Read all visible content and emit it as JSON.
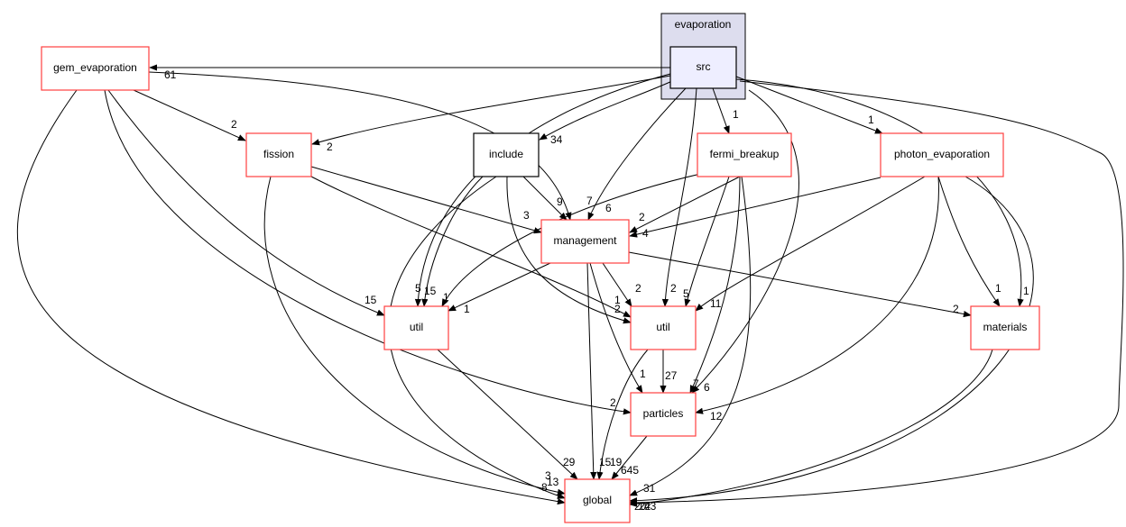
{
  "graph": {
    "cluster": {
      "label": "evaporation",
      "fill": "#ddddee",
      "border": "#000000"
    },
    "nodes": {
      "src": {
        "label": "src",
        "fill": "#eeeeff",
        "border": "#000000"
      },
      "gem_evaporation": {
        "label": "gem_evaporation",
        "border": "#ff0000"
      },
      "fission": {
        "label": "fission",
        "border": "#ff0000"
      },
      "include": {
        "label": "include",
        "border": "#000000"
      },
      "fermi_breakup": {
        "label": "fermi_breakup",
        "border": "#ff0000"
      },
      "photon_evaporation": {
        "label": "photon_evaporation",
        "border": "#ff0000"
      },
      "management": {
        "label": "management",
        "border": "#ff0000"
      },
      "util_1": {
        "label": "util",
        "border": "#ff0000"
      },
      "util_2": {
        "label": "util",
        "border": "#ff0000"
      },
      "materials": {
        "label": "materials",
        "border": "#ff0000"
      },
      "particles": {
        "label": "particles",
        "border": "#ff0000"
      },
      "global": {
        "label": "global",
        "border": "#ff0000"
      }
    },
    "edges": [
      {
        "from": "src",
        "to": "gem_evaporation",
        "count": "61"
      },
      {
        "from": "gem_evaporation",
        "to": "fission",
        "count": "2"
      },
      {
        "from": "src",
        "to": "fission",
        "count": "2"
      },
      {
        "from": "src",
        "to": "include",
        "count": "34"
      },
      {
        "from": "src",
        "to": "fermi_breakup",
        "count": "1"
      },
      {
        "from": "src",
        "to": "photon_evaporation",
        "count": "1"
      },
      {
        "from": "include",
        "to": "management",
        "count": "9"
      },
      {
        "from": "gem_evaporation",
        "to": "management",
        "count": "7"
      },
      {
        "from": "src",
        "to": "management",
        "count": "6"
      },
      {
        "from": "fission",
        "to": "management",
        "count": "3"
      },
      {
        "from": "fermi_breakup",
        "to": "management",
        "count": "2"
      },
      {
        "from": "photon_evaporation",
        "to": "management",
        "count": "4"
      },
      {
        "from": "src",
        "to": "util_1",
        "count": "5"
      },
      {
        "from": "include",
        "to": "util_1",
        "count": "15"
      },
      {
        "from": "fermi_breakup",
        "to": "util_1",
        "count": "1"
      },
      {
        "from": "management",
        "to": "util_1",
        "count": "1"
      },
      {
        "from": "gem_evaporation",
        "to": "util_1",
        "count": "15"
      },
      {
        "from": "fission",
        "to": "util_2",
        "count": "1"
      },
      {
        "from": "include",
        "to": "util_2",
        "count": "2"
      },
      {
        "from": "management",
        "to": "util_2",
        "count": "2"
      },
      {
        "from": "src",
        "to": "util_2",
        "count": "2"
      },
      {
        "from": "fermi_breakup",
        "to": "util_2",
        "count": "5"
      },
      {
        "from": "photon_evaporation",
        "to": "util_2",
        "count": "11"
      },
      {
        "from": "management",
        "to": "materials",
        "count": "2"
      },
      {
        "from": "photon_evaporation",
        "to": "materials",
        "count": "1"
      },
      {
        "from": "src",
        "to": "materials",
        "count": "1"
      },
      {
        "from": "management",
        "to": "particles",
        "count": "1"
      },
      {
        "from": "util_2",
        "to": "particles",
        "count": "27"
      },
      {
        "from": "fermi_breakup",
        "to": "particles",
        "count": "7"
      },
      {
        "from": "src",
        "to": "particles",
        "count": "6"
      },
      {
        "from": "gem_evaporation",
        "to": "particles",
        "count": "2"
      },
      {
        "from": "photon_evaporation",
        "to": "particles",
        "count": "12"
      },
      {
        "from": "util_1",
        "to": "global",
        "count": "29"
      },
      {
        "from": "management",
        "to": "global",
        "count": "15"
      },
      {
        "from": "util_2",
        "to": "global",
        "count": "19"
      },
      {
        "from": "particles",
        "to": "global",
        "count": "645"
      },
      {
        "from": "fission",
        "to": "global",
        "count": "3"
      },
      {
        "from": "include",
        "to": "global",
        "count": "13"
      },
      {
        "from": "gem_evaporation",
        "to": "global",
        "count": "8"
      },
      {
        "from": "fermi_breakup",
        "to": "global",
        "count": "31"
      },
      {
        "from": "photon_evaporation",
        "to": "global",
        "count": "22"
      },
      {
        "from": "materials",
        "to": "global",
        "count": "43"
      },
      {
        "from": "src",
        "to": "global",
        "count": "20"
      }
    ]
  }
}
